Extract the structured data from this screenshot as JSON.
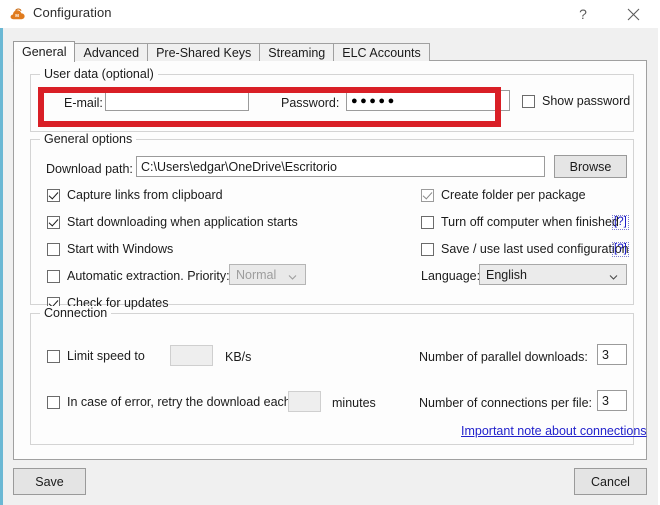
{
  "window": {
    "title": "Configuration",
    "icon": "cloud-icon",
    "accent_color": "#6bb8d4",
    "help_button": "?",
    "close_button": "✕"
  },
  "tabs": [
    {
      "label": "General",
      "active": true
    },
    {
      "label": "Advanced",
      "active": false
    },
    {
      "label": "Pre-Shared Keys",
      "active": false
    },
    {
      "label": "Streaming",
      "active": false
    },
    {
      "label": "ELC Accounts",
      "active": false
    }
  ],
  "user_data": {
    "group_title": "User data (optional)",
    "email_label": "E-mail:",
    "email_value": "",
    "password_label": "Password:",
    "password_value": "●●●●●",
    "show_password_label": "Show password",
    "show_password_checked": false,
    "highlight_color": "#d91f26"
  },
  "general_options": {
    "group_title": "General options",
    "download_path_label": "Download path:",
    "download_path_value": "C:\\Users\\edgar\\OneDrive\\Escritorio",
    "browse_label": "Browse",
    "capture_links_label": "Capture links from clipboard",
    "capture_links_checked": true,
    "start_downloading_label": "Start downloading when application starts",
    "start_downloading_checked": true,
    "start_with_windows_label": "Start with Windows",
    "start_with_windows_checked": false,
    "auto_extraction_label": "Automatic extraction. Priority:",
    "auto_extraction_checked": false,
    "priority_value": "Normal",
    "check_updates_label": "Check for updates",
    "check_updates_checked": true,
    "create_folder_label": "Create folder per package",
    "create_folder_checked": true,
    "turn_off_label": "Turn off computer when finished",
    "turn_off_checked": false,
    "turn_off_help": "[?]",
    "save_config_label": "Save / use last used configuration",
    "save_config_checked": false,
    "save_config_help": "[?]",
    "language_label": "Language:",
    "language_value": "English"
  },
  "connection": {
    "group_title": "Connection",
    "limit_speed_label": "Limit speed to",
    "limit_speed_checked": false,
    "limit_speed_value": "",
    "kbs_label": "KB/s",
    "retry_label": "In case of error, retry the download each",
    "retry_checked": false,
    "retry_value": "",
    "minutes_label": "minutes",
    "parallel_downloads_label": "Number of parallel downloads:",
    "parallel_downloads_value": "3",
    "connections_per_file_label": "Number of connections per file:",
    "connections_per_file_value": "3",
    "note_link": "Important note about connections"
  },
  "footer": {
    "save_label": "Save",
    "cancel_label": "Cancel"
  }
}
